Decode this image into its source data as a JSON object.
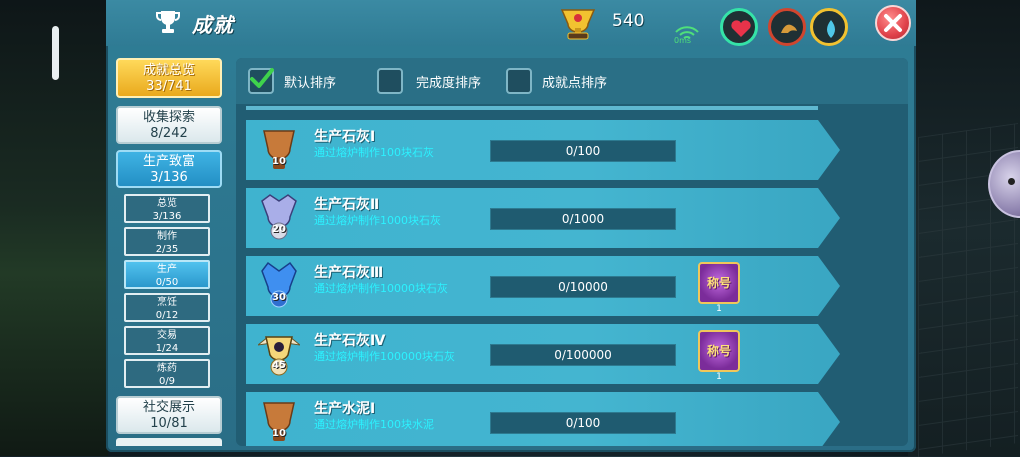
{
  "header": {
    "title": "成就",
    "points": "540",
    "ping": "0ms"
  },
  "icons": {
    "trophy": "trophy-icon",
    "cup": "gold-cup-icon",
    "wifi": "wifi-icon",
    "heart": "heart-icon",
    "stamina": "stamina-icon",
    "water": "water-drop-icon",
    "close": "close-icon"
  },
  "nav": {
    "summary": {
      "label": "成就总览",
      "count": "33/741"
    },
    "collect": {
      "label": "收集探索",
      "count": "8/242"
    },
    "wealth": {
      "label": "生产致富",
      "count": "3/136"
    },
    "social": {
      "label": "社交展示",
      "count": "10/81"
    },
    "sub": [
      {
        "label": "总览",
        "count": "3/136"
      },
      {
        "label": "制作",
        "count": "2/35"
      },
      {
        "label": "生产",
        "count": "0/50"
      },
      {
        "label": "烹饪",
        "count": "0/12"
      },
      {
        "label": "交易",
        "count": "1/24"
      },
      {
        "label": "炼药",
        "count": "0/9"
      }
    ]
  },
  "sort": {
    "default": "默认排序",
    "completion": "完成度排序",
    "points": "成就点排序"
  },
  "achievements": [
    {
      "name": "生产石灰Ⅰ",
      "desc": "通过熔炉制作100块石灰",
      "progress": "0/100",
      "medal": "10",
      "reward": "",
      "reward_count": ""
    },
    {
      "name": "生产石灰Ⅱ",
      "desc": "通过熔炉制作1000块石灰",
      "progress": "0/1000",
      "medal": "20",
      "reward": "",
      "reward_count": ""
    },
    {
      "name": "生产石灰Ⅲ",
      "desc": "通过熔炉制作10000块石灰",
      "progress": "0/10000",
      "medal": "30",
      "reward": "称号",
      "reward_count": "1"
    },
    {
      "name": "生产石灰Ⅳ",
      "desc": "通过熔炉制作100000块石灰",
      "progress": "0/100000",
      "medal": "45",
      "reward": "称号",
      "reward_count": "1"
    },
    {
      "name": "生产水泥Ⅰ",
      "desc": "通过熔炉制作100块水泥",
      "progress": "0/100",
      "medal": "10",
      "reward": "",
      "reward_count": ""
    }
  ],
  "colors": {
    "accent": "#2cf2ff",
    "gold": "#e9a91d",
    "panel": "#2f7e96"
  }
}
